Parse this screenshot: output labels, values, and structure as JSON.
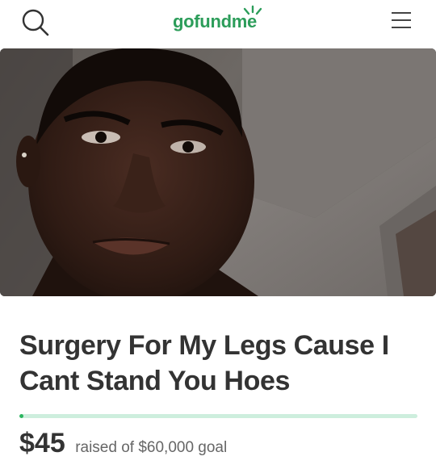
{
  "header": {
    "logo_text": "gofundme",
    "search_icon": "search-icon",
    "menu_icon": "hamburger-menu-icon",
    "brand_color": "#2c9d5a"
  },
  "hero": {
    "image": "campaign-photo"
  },
  "campaign": {
    "title": "Surgery For My Legs Cause I Cant Stand You Hoes",
    "raised_amount": "$45",
    "raised_text": "raised of $60,000 goal",
    "progress_fraction": 0.00075,
    "progress_color": "#2bb55f",
    "track_color": "#cdeedd"
  }
}
